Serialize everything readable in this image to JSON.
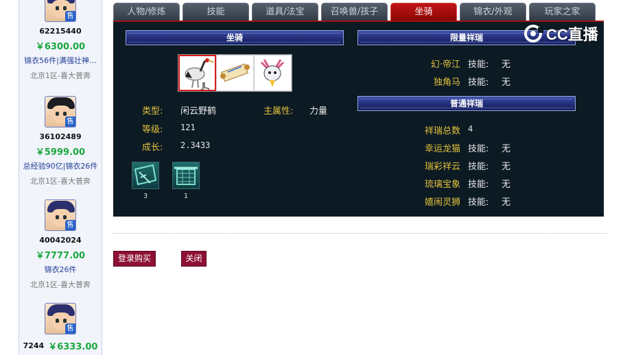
{
  "listings": [
    {
      "id": "62215440",
      "price": "￥6300.00",
      "desc": "锦衣56件|满强壮神…",
      "server": "北京1区-喜大普奔",
      "sell_tag": "售"
    },
    {
      "id": "36102489",
      "price": "￥5999.00",
      "desc": "总经验90亿|锦衣26件",
      "server": "北京1区-喜大普奔",
      "sell_tag": "售"
    },
    {
      "id": "40042024",
      "price": "￥7777.00",
      "desc": "锦衣26件",
      "server": "北京1区-喜大普奔",
      "sell_tag": "售"
    },
    {
      "id": "7244",
      "price": "￥6333.00",
      "desc": "",
      "server": "",
      "sell_tag": "售"
    }
  ],
  "tabs": [
    {
      "label": "人物/修炼"
    },
    {
      "label": "技能"
    },
    {
      "label": "道具/法宝"
    },
    {
      "label": "召唤兽/孩子"
    },
    {
      "label": "坐骑",
      "active": true
    },
    {
      "label": "锦衣/外观"
    },
    {
      "label": "玩家之家"
    }
  ],
  "mount": {
    "header": "坐骑",
    "type_label": "类型:",
    "type_value": "闲云野鹤",
    "attr_label": "主属性:",
    "attr_value": "力量",
    "level_label": "等级:",
    "level_value": "121",
    "growth_label": "成长:",
    "growth_value": "2.3433",
    "thumbnails": [
      "crane-mount",
      "scroll-item",
      "deer-mount"
    ],
    "skills": [
      {
        "icon": "skill-book-icon",
        "count": "3"
      },
      {
        "icon": "skill-scroll-icon",
        "count": "1"
      }
    ]
  },
  "limited": {
    "header": "限量祥瑞",
    "rows": [
      {
        "name": "幻·帝江",
        "skill_label": "技能:",
        "skill_value": "无"
      },
      {
        "name": "独角马",
        "skill_label": "技能:",
        "skill_value": "无"
      }
    ]
  },
  "normal": {
    "header": "普通祥瑞",
    "total_label": "祥瑞总数",
    "total_value": "4",
    "rows": [
      {
        "name": "幸运龙猫",
        "skill_label": "技能:",
        "skill_value": "无"
      },
      {
        "name": "瑞彩祥云",
        "skill_label": "技能:",
        "skill_value": "无"
      },
      {
        "name": "琉璃宝象",
        "skill_label": "技能:",
        "skill_value": "无"
      },
      {
        "name": "嬉闹灵狮",
        "skill_label": "技能:",
        "skill_value": "无"
      }
    ]
  },
  "watermark": {
    "text": "CC直播"
  },
  "actions": {
    "login_buy": "登录购买",
    "close": "关闭"
  },
  "colors": {
    "accent_red": "#a01010",
    "price_green": "#1aa73c",
    "panel_bg": "#0c1a24",
    "gold_label": "#e0c13a",
    "button_bg": "#8e1034"
  }
}
